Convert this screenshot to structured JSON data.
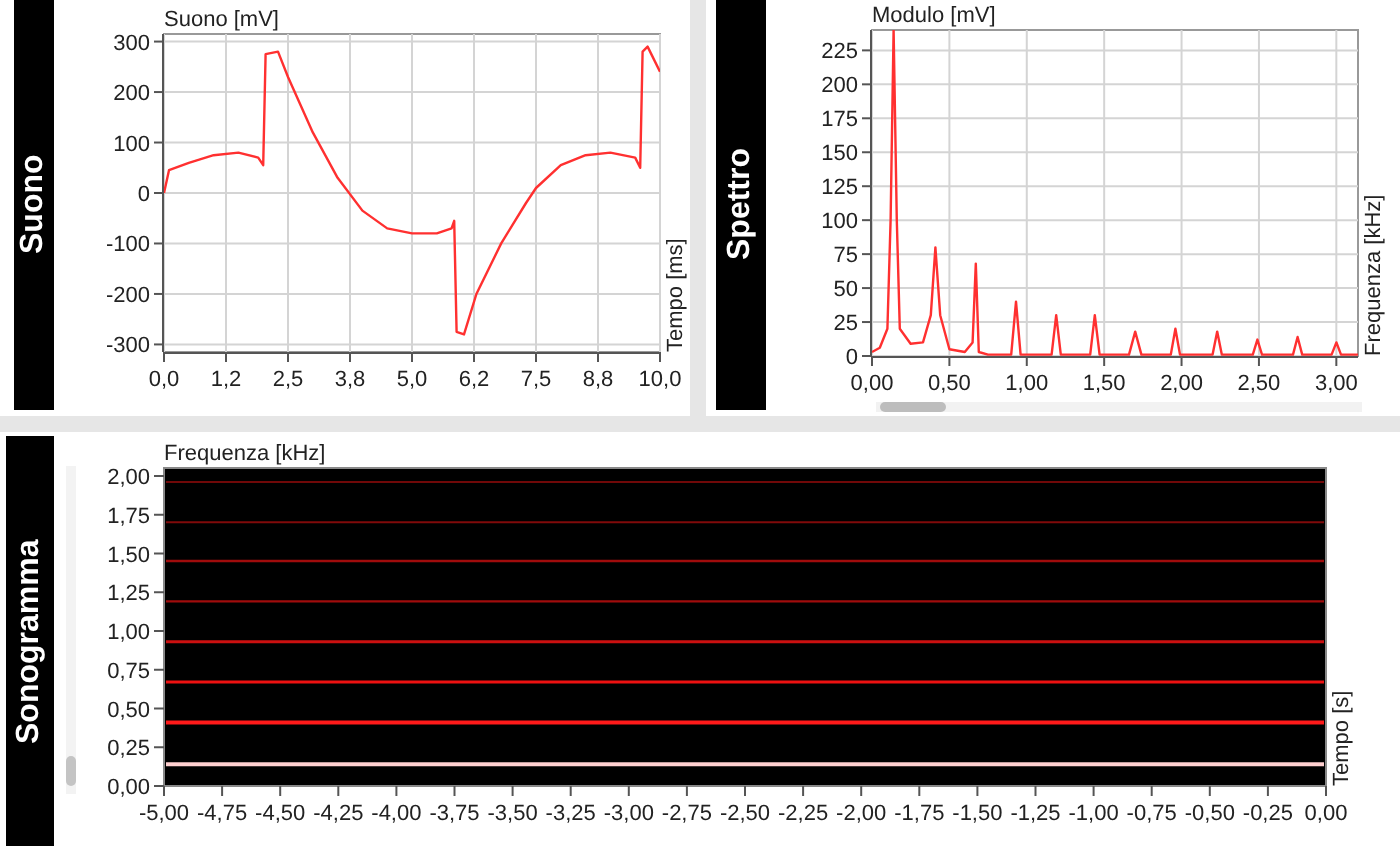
{
  "panels": [
    {
      "label": "Suono",
      "x_axis_title": "Tempo [ms]",
      "chart_data": {
        "type": "line",
        "grid": true,
        "ylabel": "Suono [mV]",
        "xlim": [
          0,
          10
        ],
        "ylim": [
          -315,
          315
        ],
        "xticks": [
          {
            "value": 0,
            "label": "0,0"
          },
          {
            "value": 1.25,
            "label": "1,2"
          },
          {
            "value": 2.5,
            "label": "2,5"
          },
          {
            "value": 3.75,
            "label": "3,8"
          },
          {
            "value": 5,
            "label": "5,0"
          },
          {
            "value": 6.25,
            "label": "6,2"
          },
          {
            "value": 7.5,
            "label": "7,5"
          },
          {
            "value": 8.75,
            "label": "8,8"
          },
          {
            "value": 10,
            "label": "10,0"
          }
        ],
        "yticks": [
          -300,
          -200,
          -100,
          0,
          100,
          200,
          300
        ],
        "x": [
          0,
          0.1,
          0.5,
          1.0,
          1.5,
          1.9,
          2.0,
          2.05,
          2.3,
          2.5,
          3.0,
          3.5,
          4.0,
          4.5,
          5.0,
          5.5,
          5.8,
          5.85,
          5.9,
          6.05,
          6.3,
          6.8,
          7.3,
          7.5,
          8.0,
          8.5,
          9.0,
          9.5,
          9.6,
          9.65,
          9.75,
          10
        ],
        "series": [
          {
            "values": [
              0,
              45,
              60,
              75,
              80,
              70,
              55,
              275,
              280,
              230,
              120,
              30,
              -35,
              -70,
              -80,
              -80,
              -70,
              -55,
              -275,
              -280,
              -200,
              -100,
              -20,
              10,
              55,
              75,
              80,
              70,
              50,
              280,
              290,
              240
            ]
          }
        ]
      }
    },
    {
      "label": "Spettro",
      "x_axis_title": "Frequenza [kHz]",
      "chart_data": {
        "type": "line",
        "grid": true,
        "ylabel": "Modulo [mV]",
        "xlim": [
          0,
          3.14
        ],
        "ylim": [
          0,
          240
        ],
        "xticks": [
          {
            "value": 0,
            "label": "0,00"
          },
          {
            "value": 0.5,
            "label": "0,50"
          },
          {
            "value": 1,
            "label": "1,00"
          },
          {
            "value": 1.5,
            "label": "1,50"
          },
          {
            "value": 2,
            "label": "2,00"
          },
          {
            "value": 2.5,
            "label": "2,50"
          },
          {
            "value": 3,
            "label": "3,00"
          }
        ],
        "yticks": [
          0,
          25,
          50,
          75,
          100,
          125,
          150,
          175,
          200,
          225
        ],
        "x": [
          0,
          0.05,
          0.1,
          0.12,
          0.14,
          0.16,
          0.18,
          0.25,
          0.33,
          0.38,
          0.41,
          0.44,
          0.5,
          0.6,
          0.65,
          0.67,
          0.69,
          0.75,
          0.9,
          0.93,
          0.96,
          1.16,
          1.19,
          1.22,
          1.41,
          1.44,
          1.47,
          1.66,
          1.7,
          1.74,
          1.93,
          1.96,
          1.99,
          2.2,
          2.23,
          2.26,
          2.46,
          2.49,
          2.52,
          2.72,
          2.75,
          2.78,
          2.97,
          3.0,
          3.03,
          3.14
        ],
        "series": [
          {
            "values": [
              3,
              6,
              20,
              100,
              240,
              100,
              20,
              9,
              10,
              30,
              80,
              30,
              5,
              3,
              10,
              68,
              3,
              1,
              1,
              40,
              1,
              1,
              30,
              1,
              1,
              30,
              1,
              1,
              18,
              1,
              1,
              20,
              1,
              1,
              18,
              1,
              1,
              12,
              1,
              1,
              14,
              1,
              1,
              10,
              1,
              1
            ]
          }
        ]
      }
    }
  ],
  "sonogram": {
    "label": "Sonogramma",
    "ylabel": "Frequenza [kHz]",
    "xlabel": "Tempo [s]",
    "yticks": [
      "2,00",
      "1,75",
      "1,50",
      "1,25",
      "1,00",
      "0,75",
      "0,50",
      "0,25",
      "0,00"
    ],
    "xticks": [
      "-5,00",
      "-4,75",
      "-4,50",
      "-4,25",
      "-4,00",
      "-3,75",
      "-3,50",
      "-3,25",
      "-3,00",
      "-2,75",
      "-2,50",
      "-2,25",
      "-2,00",
      "-1,75",
      "-1,50",
      "-1,25",
      "-1,00",
      "-0,75",
      "-0,50",
      "-0,25",
      "0,00"
    ]
  }
}
